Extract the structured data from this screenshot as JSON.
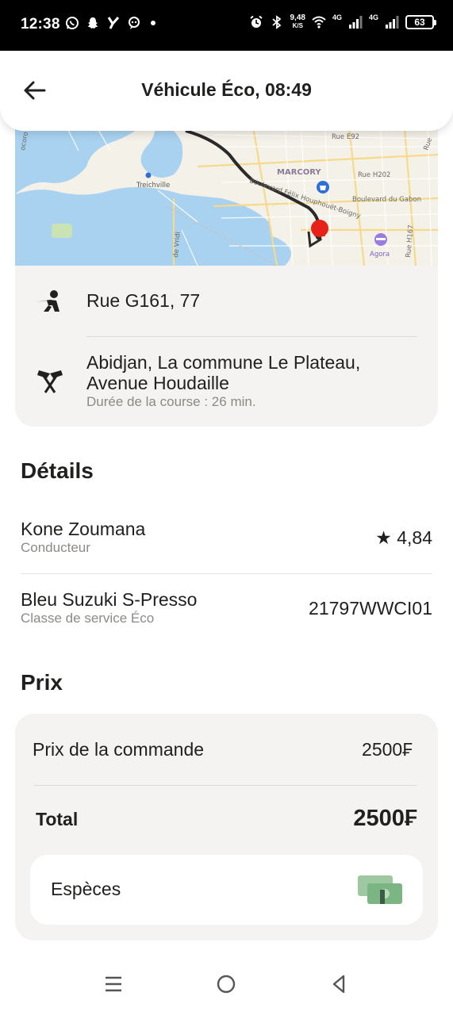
{
  "status_bar": {
    "time": "12:38",
    "speed_value": "9,48",
    "speed_unit": "K/S",
    "net1": "4G",
    "net2": "4G",
    "battery": "63"
  },
  "header": {
    "title": "Véhicule Éco, 08:49",
    "back_icon": "arrow-left-icon"
  },
  "map": {
    "labels": {
      "treichville": "Treichville",
      "marcory": "MARCORY",
      "rue_e92": "Rue E92",
      "rue_h202": "Rue H202",
      "boulevard_gabon": "Boulevard du Gabon",
      "boulevard_felix": "Boulevard Félix Houphouët-Boigny",
      "agora": "Agora",
      "vridi": "de Vridi",
      "rue_h167": "Rue H167",
      "corner_left": "ocoro",
      "corner_right": "Rue"
    }
  },
  "route": {
    "from": "Rue G161, 77",
    "to": "Abidjan, La commune Le Plateau, Avenue Houdaille",
    "duration": "Durée de la course : 26 min.",
    "from_icon": "passenger-icon",
    "to_icon": "finish-flags-icon"
  },
  "details": {
    "title": "Détails",
    "driver_name": "Kone Zoumana",
    "driver_role": "Conducteur",
    "rating_star": "★",
    "rating": "4,84",
    "car_name": "Bleu Suzuki S-Presso",
    "car_class": "Classe de service Éco",
    "plate": "21797WWCI01"
  },
  "price": {
    "title": "Prix",
    "order_label": "Prix de la commande",
    "order_value": "2500₣",
    "total_label": "Total",
    "total_value": "2500₣",
    "payment_label": "Espèces",
    "payment_icon": "cash-icon"
  },
  "colors": {
    "accent_pin": "#e8201a",
    "card_bg": "#f4f3f1",
    "text": "#21201f",
    "muted": "#8c8a86",
    "water": "#a8d2f0",
    "route": "#2a2a2a"
  }
}
